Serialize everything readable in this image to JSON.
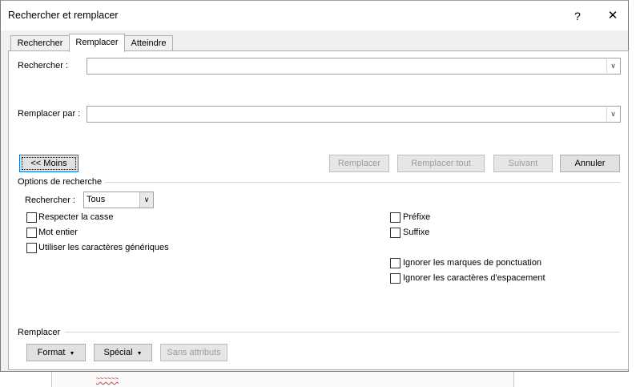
{
  "window": {
    "title": "Rechercher et remplacer",
    "help_label": "?",
    "close_label": "✕"
  },
  "tabs": [
    {
      "label": "Rechercher"
    },
    {
      "label": "Remplacer"
    },
    {
      "label": "Atteindre"
    }
  ],
  "find": {
    "label": "Rechercher :",
    "value": ""
  },
  "replace": {
    "label": "Remplacer par :",
    "value": ""
  },
  "buttons": {
    "less": "<< Moins",
    "replace": "Remplacer",
    "replace_all": "Remplacer tout",
    "next": "Suivant",
    "cancel": "Annuler"
  },
  "options": {
    "section_label": "Options de recherche",
    "search_label": "Rechercher :",
    "search_value": "Tous",
    "match_case": "Respecter la casse",
    "whole_word": "Mot entier",
    "wildcards": "Utiliser les caractères génériques",
    "prefix": "Préfixe",
    "suffix": "Suffixe",
    "ignore_punct": "Ignorer les marques de ponctuation",
    "ignore_space": "Ignorer les caractères d'espacement"
  },
  "replace_section": {
    "label": "Remplacer",
    "format": "Format",
    "special": "Spécial",
    "no_format": "Sans attributs"
  }
}
